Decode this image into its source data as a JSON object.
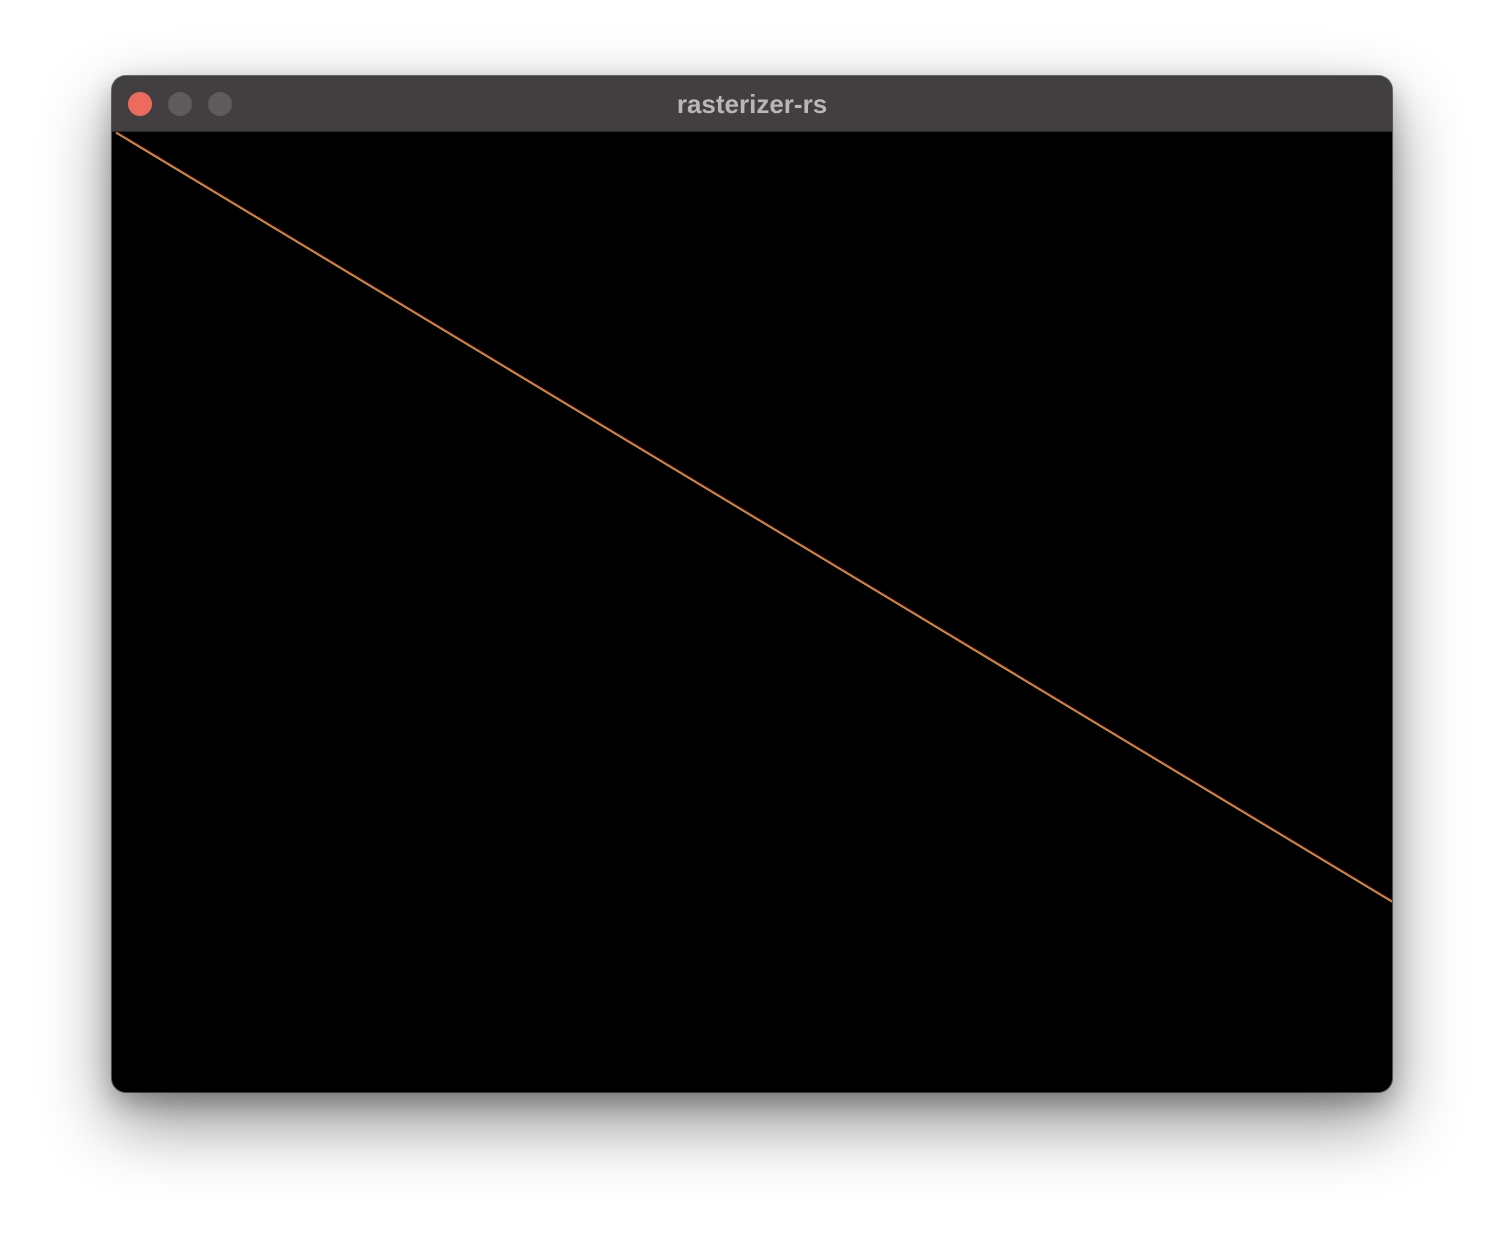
{
  "window": {
    "title": "rasterizer-rs",
    "controls": [
      {
        "name": "close",
        "color": "#ec6a5e"
      },
      {
        "name": "minimize",
        "color": "#5e5c5d"
      },
      {
        "name": "zoom",
        "color": "#5e5c5d"
      }
    ]
  },
  "canvas": {
    "background": "#000000",
    "line": {
      "color": "#e8603a",
      "accent_color": "#b8c040"
    }
  }
}
